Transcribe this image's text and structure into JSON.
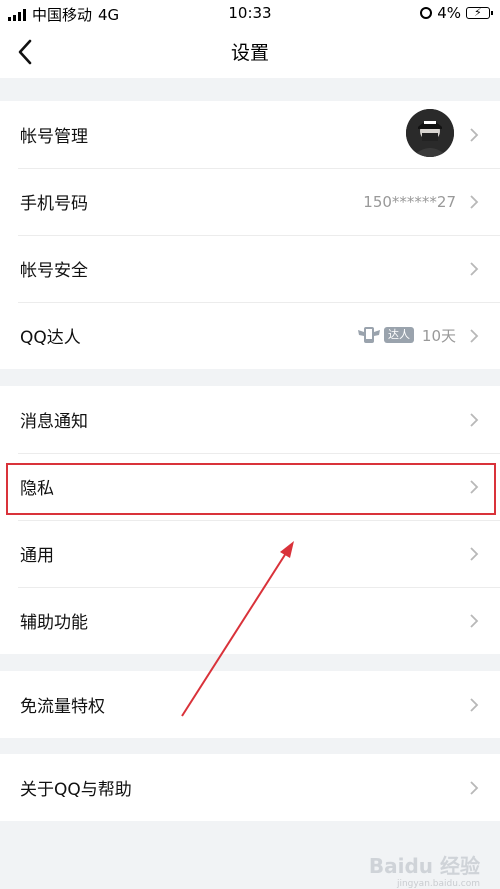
{
  "status_bar": {
    "carrier": "中国移动",
    "network": "4G",
    "time": "10:33",
    "battery": "4%"
  },
  "nav": {
    "title": "设置"
  },
  "groups": [
    {
      "rows": [
        {
          "label": "帐号管理",
          "has_avatar": true
        },
        {
          "label": "手机号码",
          "value": "150******27"
        },
        {
          "label": "帐号安全"
        },
        {
          "label": "QQ达人",
          "badge": "达人",
          "value": "10天"
        }
      ]
    },
    {
      "rows": [
        {
          "label": "消息通知"
        },
        {
          "label": "隐私"
        },
        {
          "label": "通用"
        },
        {
          "label": "辅助功能"
        }
      ]
    },
    {
      "rows": [
        {
          "label": "免流量特权"
        }
      ]
    },
    {
      "rows": [
        {
          "label": "关于QQ与帮助"
        }
      ]
    }
  ],
  "annotation": {
    "highlight_color": "#d9323a"
  },
  "watermark": {
    "text": "Baidu 经验",
    "sub": "jingyan.baidu.com"
  }
}
